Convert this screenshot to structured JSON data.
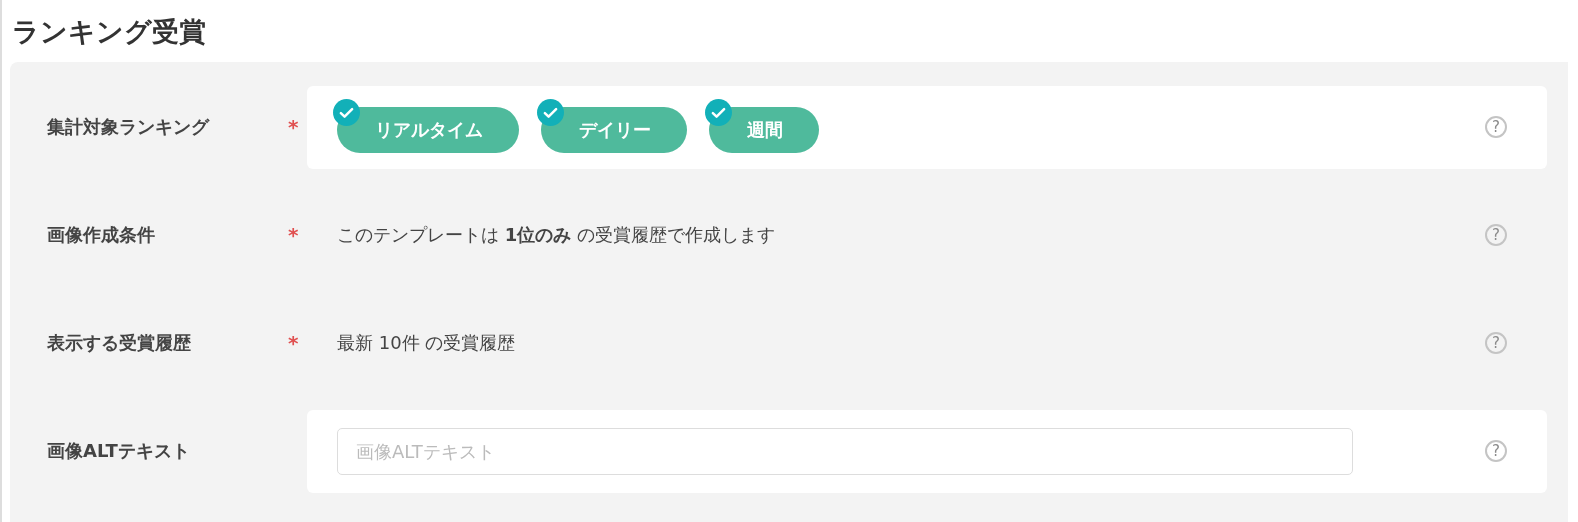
{
  "title": "ランキング受賞",
  "rows": [
    {
      "kind": "chips",
      "label": "集計対象ランキング",
      "required": "*",
      "help": "?",
      "chips": [
        {
          "label": "リアルタイム",
          "checked": true
        },
        {
          "label": "デイリー",
          "checked": true
        },
        {
          "label": "週間",
          "checked": true
        }
      ]
    },
    {
      "kind": "text",
      "label": "画像作成条件",
      "required": "*",
      "help": "?",
      "text": "このテンプレートは **1位のみ** の受賞履歴で作成します"
    },
    {
      "kind": "text",
      "label": "表示する受賞履歴",
      "required": "*",
      "help": "?",
      "text": "最新 10件 の受賞履歴"
    },
    {
      "kind": "input",
      "label": "画像ALTテキスト",
      "help": "?",
      "placeholder": "画像ALTテキスト"
    }
  ]
}
